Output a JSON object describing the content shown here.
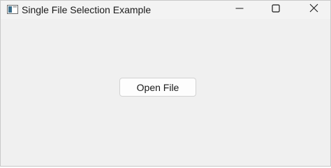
{
  "window": {
    "title": "Single File Selection Example",
    "app_icon": "window-app-icon",
    "controls": {
      "minimize_icon": "minimize-icon",
      "maximize_icon": "maximize-icon",
      "close_icon": "close-icon"
    }
  },
  "main": {
    "open_file_label": "Open File"
  }
}
